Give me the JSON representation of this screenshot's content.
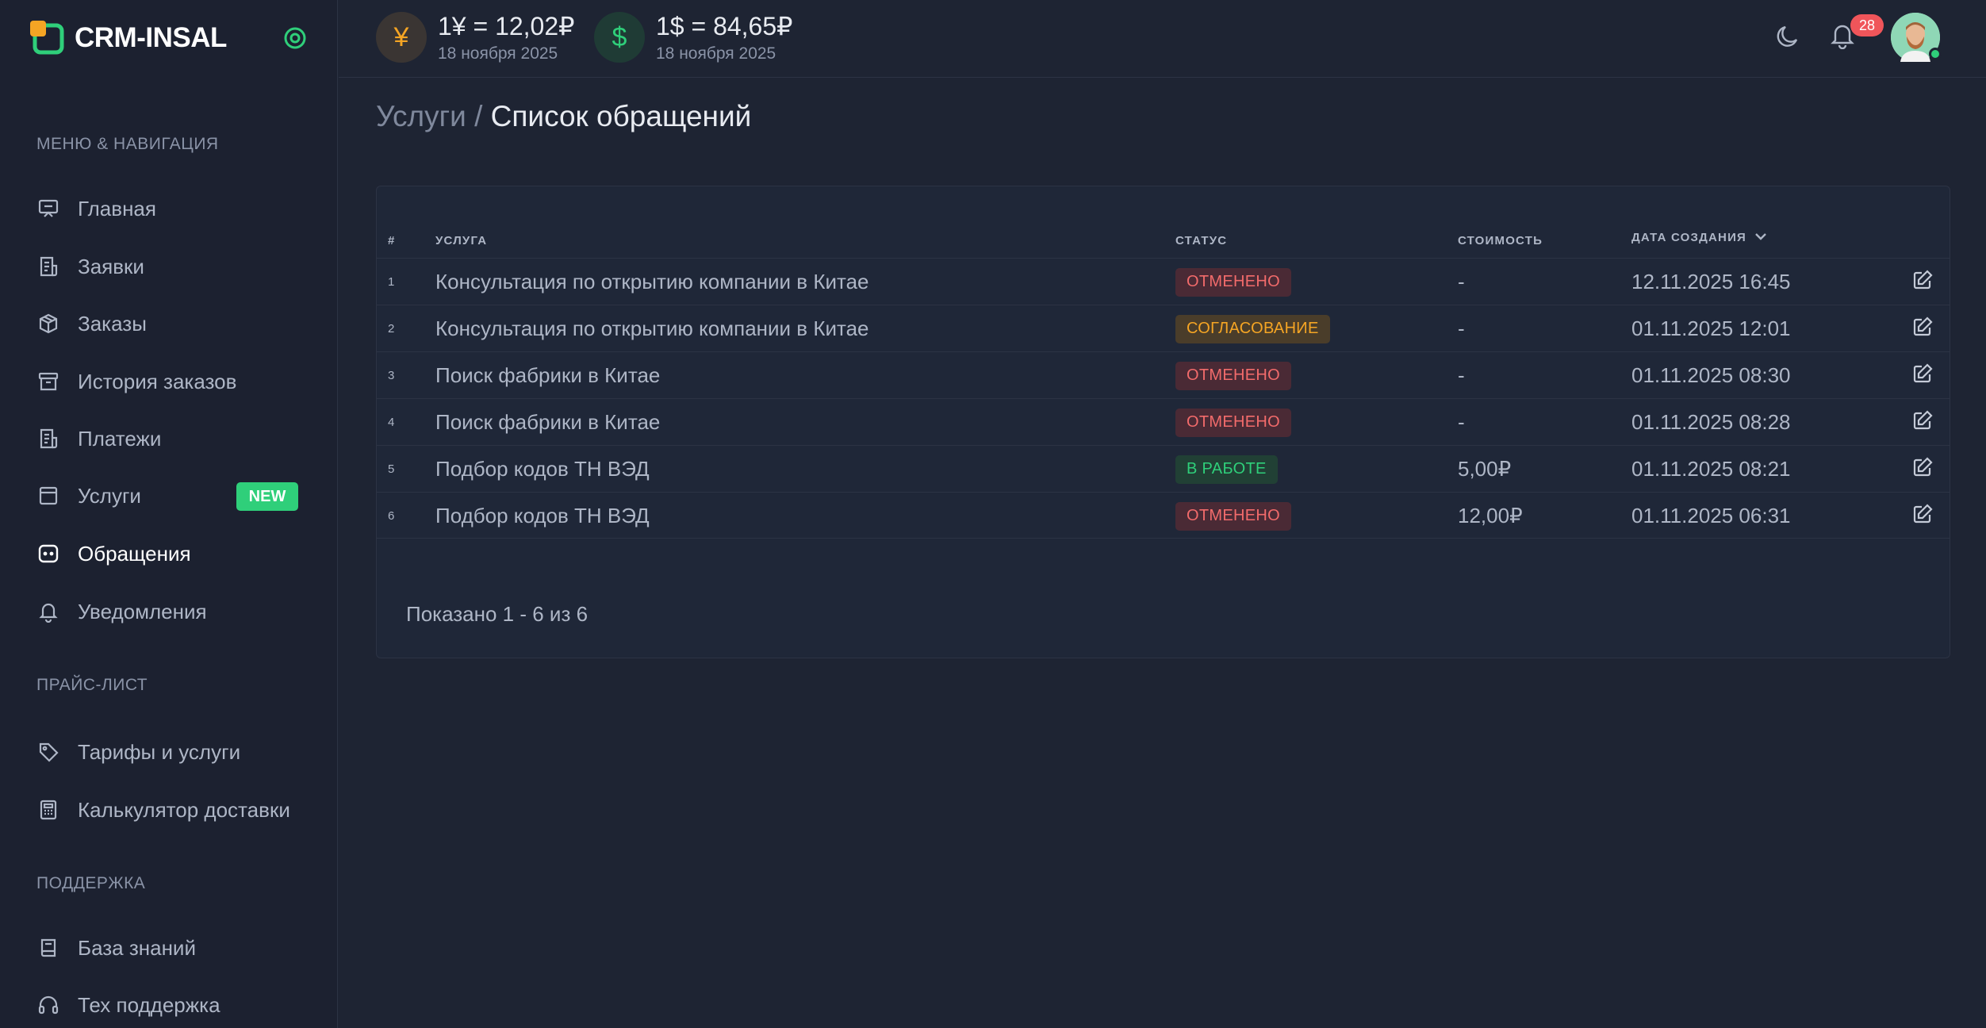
{
  "brand": {
    "name": "CRM-INSAL",
    "accent": "#2fcf7a",
    "logo_orange": "#f5a524"
  },
  "sidebar": {
    "sections": [
      {
        "title": "МЕНЮ & НАВИГАЦИЯ"
      },
      {
        "title": "ПРАЙС-ЛИСТ"
      },
      {
        "title": "ПОДДЕРЖКА"
      }
    ],
    "items": [
      {
        "label": "Главная",
        "icon": "presentation-icon"
      },
      {
        "label": "Заявки",
        "icon": "receipt-icon"
      },
      {
        "label": "Заказы",
        "icon": "box-icon"
      },
      {
        "label": "История заказов",
        "icon": "archive-icon"
      },
      {
        "label": "Платежи",
        "icon": "receipt-icon"
      },
      {
        "label": "Услуги",
        "icon": "window-icon",
        "badge": "NEW"
      },
      {
        "label": "Обращения",
        "icon": "chat-icon",
        "active": true
      },
      {
        "label": "Уведомления",
        "icon": "bell-icon"
      },
      {
        "label": "Тарифы и услуги",
        "icon": "tag-icon"
      },
      {
        "label": "Калькулятор доставки",
        "icon": "calculator-icon"
      },
      {
        "label": "База знаний",
        "icon": "book-icon"
      },
      {
        "label": "Тех поддержка",
        "icon": "headset-icon"
      }
    ]
  },
  "header": {
    "rates": [
      {
        "symbol": "¥",
        "value": "1¥ = 12,02₽",
        "date": "18 ноября 2025",
        "color": "#f5a524"
      },
      {
        "symbol": "$",
        "value": "1$ = 84,65₽",
        "date": "18 ноября 2025",
        "color": "#2fcf7a"
      }
    ],
    "notifications_count": "28"
  },
  "breadcrumb": {
    "parent": "Услуги",
    "separator": " / ",
    "current": "Список обращений"
  },
  "table": {
    "columns": {
      "num": "#",
      "service": "УСЛУГА",
      "status": "СТАТУС",
      "cost": "СТОИМОСТЬ",
      "date": "ДАТА СОЗДАНИЯ"
    },
    "rows": [
      {
        "num": "1",
        "service": "Консультация по открытию компании в Китае",
        "status": "ОТМЕНЕНО",
        "status_kind": "cancel",
        "cost": "-",
        "date": "12.11.2025 16:45"
      },
      {
        "num": "2",
        "service": "Консультация по открытию компании в Китае",
        "status": "СОГЛАСОВАНИЕ",
        "status_kind": "approve",
        "cost": "-",
        "date": "01.11.2025 12:01"
      },
      {
        "num": "3",
        "service": "Поиск фабрики в Китае",
        "status": "ОТМЕНЕНО",
        "status_kind": "cancel",
        "cost": "-",
        "date": "01.11.2025 08:30"
      },
      {
        "num": "4",
        "service": "Поиск фабрики в Китае",
        "status": "ОТМЕНЕНО",
        "status_kind": "cancel",
        "cost": "-",
        "date": "01.11.2025 08:28"
      },
      {
        "num": "5",
        "service": "Подбор кодов ТН ВЭД",
        "status": "В РАБОТЕ",
        "status_kind": "work",
        "cost": "5,00₽",
        "date": "01.11.2025 08:21"
      },
      {
        "num": "6",
        "service": "Подбор кодов ТН ВЭД",
        "status": "ОТМЕНЕНО",
        "status_kind": "cancel",
        "cost": "12,00₽",
        "date": "01.11.2025 06:31"
      }
    ],
    "footer": "Показано 1 - 6 из 6"
  }
}
